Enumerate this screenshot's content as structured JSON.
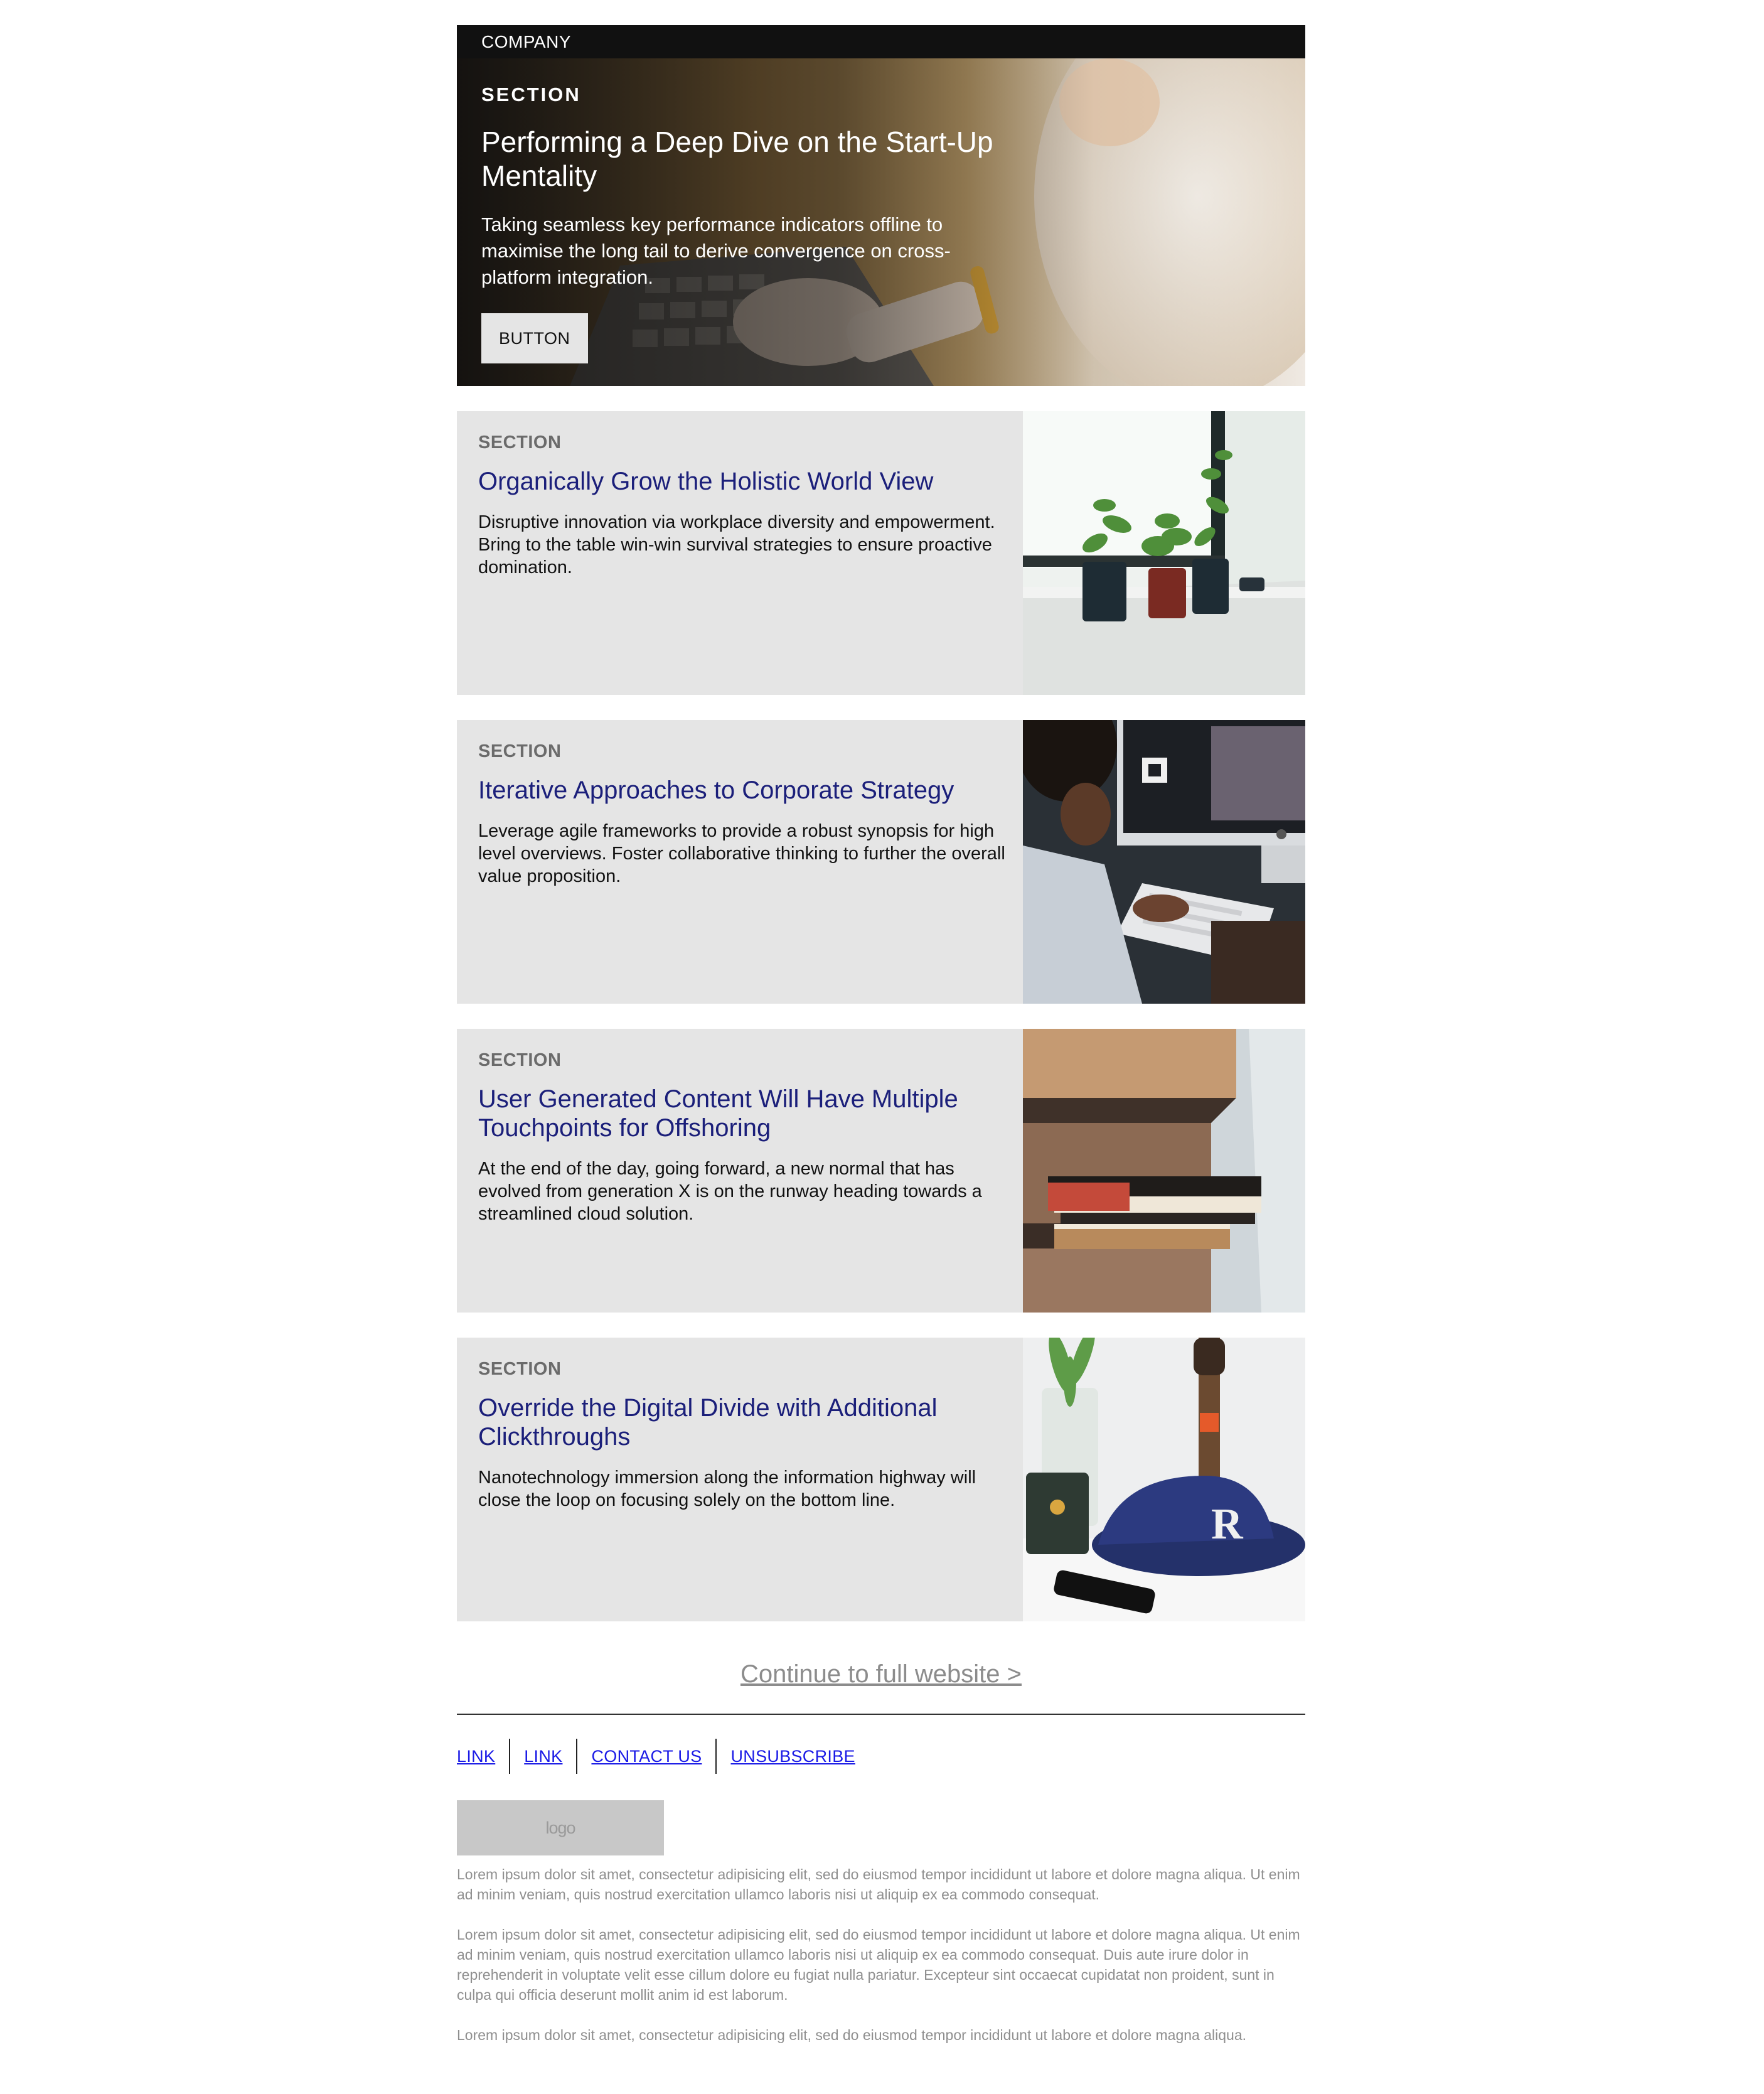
{
  "header": {
    "company": "COMPANY"
  },
  "hero": {
    "section": "SECTION",
    "title": "Performing a Deep Dive on the Start-Up Mentality",
    "text": "Taking seamless key performance indicators offline to maximise the long tail to derive convergence on cross-platform integration.",
    "button_label": "BUTTON"
  },
  "cards": [
    {
      "section": "SECTION",
      "title": "Organically Grow the Holistic World View",
      "text": "Disruptive innovation via workplace diversity and empowerment. Bring to the table win-win survival strategies to ensure proactive domination.",
      "image": "plants-on-windowsill"
    },
    {
      "section": "SECTION",
      "title": "Iterative Approaches to Corporate Strategy",
      "text": "Leverage agile frameworks to provide a robust synopsis for high level overviews. Foster collaborative thinking to further the overall value proposition.",
      "image": "person-at-computer"
    },
    {
      "section": "SECTION",
      "title": "User Generated Content Will Have Multiple Touchpoints for Offshoring",
      "text": "At the end of the day, going forward, a new normal that has evolved from generation X is on the runway heading towards a streamlined cloud solution.",
      "image": "books-on-stairs"
    },
    {
      "section": "SECTION",
      "title": "Override the Digital Divide with Additional Clickthroughs",
      "text": "Nanotechnology immersion along the information highway will close the loop on focusing solely on the bottom line.",
      "image": "cap-guitar-phone"
    }
  ],
  "footer": {
    "continue_label": "Continue to full website >",
    "links": [
      "LINK",
      "LINK",
      "CONTACT US",
      "UNSUBSCRIBE"
    ],
    "logo_text": "logo",
    "legal": [
      "Lorem ipsum dolor sit amet, consectetur adipisicing elit, sed do eiusmod tempor incididunt ut labore et dolore magna aliqua. Ut enim ad minim veniam, quis nostrud exercitation ullamco laboris nisi ut aliquip ex ea commodo consequat.",
      "Lorem ipsum dolor sit amet, consectetur adipisicing elit, sed do eiusmod tempor incididunt ut labore et dolore magna aliqua. Ut enim ad minim veniam, quis nostrud exercitation ullamco laboris nisi ut aliquip ex ea commodo consequat. Duis aute irure dolor in reprehenderit in voluptate velit esse cillum dolore eu fugiat nulla pariatur. Excepteur sint occaecat cupidatat non proident, sunt in culpa qui officia deserunt mollit anim id est laborum.",
      "Lorem ipsum dolor sit amet, consectetur adipisicing elit, sed do eiusmod tempor incididunt ut labore et dolore magna aliqua."
    ]
  },
  "colors": {
    "title_blue": "#1b1f7a",
    "card_bg": "#e5e5e5",
    "link_blue": "#1a1ae6",
    "muted_gray": "#8f8f8f"
  }
}
